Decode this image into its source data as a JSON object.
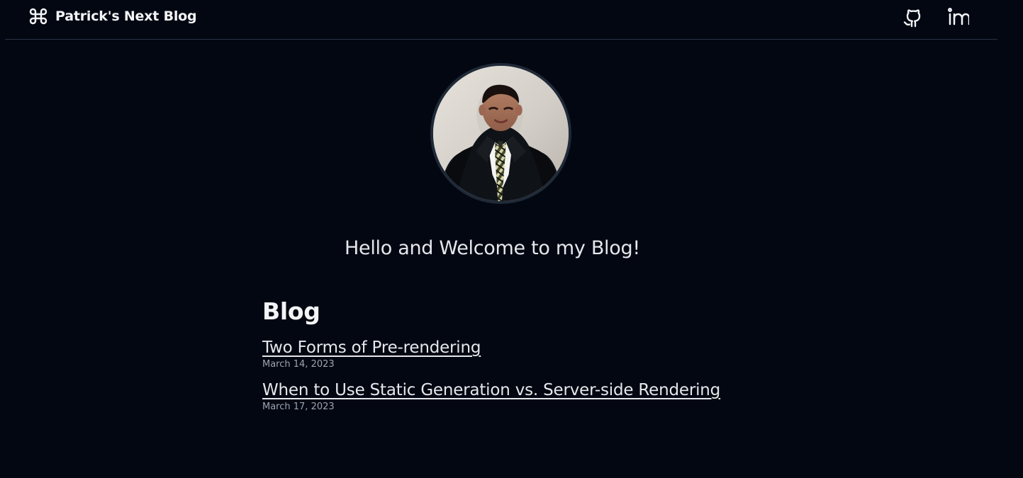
{
  "header": {
    "brand_icon": "command-icon",
    "title": "Patrick's Next Blog",
    "social": [
      {
        "icon": "github-icon"
      },
      {
        "icon": "linkedin-icon"
      }
    ]
  },
  "profile": {
    "avatar": "profile-photo"
  },
  "welcome": {
    "text": "Hello and Welcome to my Blog!"
  },
  "blog": {
    "heading": "Blog",
    "posts": [
      {
        "title": "Two Forms of Pre-rendering",
        "date": "March 14, 2023"
      },
      {
        "title": "When to Use Static Generation vs. Server-side Rendering",
        "date": "March 17, 2023"
      }
    ]
  },
  "colors": {
    "background": "#030712",
    "text": "#e5e7eb",
    "muted_text": "#9ca3af",
    "divider": "#273244",
    "avatar_ring": "#1f2937"
  }
}
